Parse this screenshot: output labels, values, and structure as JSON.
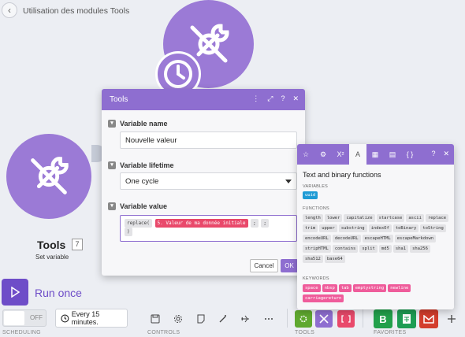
{
  "header": {
    "back_icon": "‹",
    "title": "Utilisation des modules Tools"
  },
  "module": {
    "name": "Tools",
    "badge": "7",
    "subtitle": "Set variable"
  },
  "run": {
    "label": "Run once"
  },
  "schedule": {
    "toggle_state": "OFF",
    "label": "Every 15 minutes."
  },
  "sections": {
    "scheduling": "SCHEDULING",
    "controls": "CONTROLS",
    "tools": "TOOLS",
    "favorites": "FAVORITES"
  },
  "tools_dialog": {
    "title": "Tools",
    "fields": {
      "name_label": "Variable name",
      "name_value": "Nouvelle valeur",
      "lifetime_label": "Variable lifetime",
      "lifetime_value": "One cycle",
      "value_label": "Variable value",
      "formula_fn": "replace(",
      "formula_var": "5. Valeur de ma donnée initiale",
      "formula_sep1": ";",
      "formula_sep2": ";",
      "formula_close": ")"
    },
    "cancel_label": "Cancel",
    "ok_label": "OK"
  },
  "function_panel": {
    "title": "Text and binary functions",
    "variables_label": "VARIABLES",
    "variables": [
      "uuid"
    ],
    "functions_label": "FUNCTIONS",
    "functions": [
      "length",
      "lower",
      "capitalize",
      "startcase",
      "ascii",
      "replace",
      "trim",
      "upper",
      "substring",
      "indexOf",
      "toBinary",
      "toString",
      "encodeURL",
      "decodeURL",
      "escapeHTML",
      "escapeMarkdown",
      "stripHTML",
      "contains",
      "split",
      "md5",
      "sha1",
      "sha256",
      "sha512",
      "base64"
    ],
    "keywords_label": "KEYWORDS",
    "keywords": [
      "space",
      "nbsp",
      "tab",
      "emptystring",
      "newline",
      "carriagereturn"
    ]
  },
  "colors": {
    "accent": "#8e6ed0",
    "module": "#9b7ad6",
    "keyword": "#ef5c9b",
    "variable": "#1f9bd5"
  }
}
